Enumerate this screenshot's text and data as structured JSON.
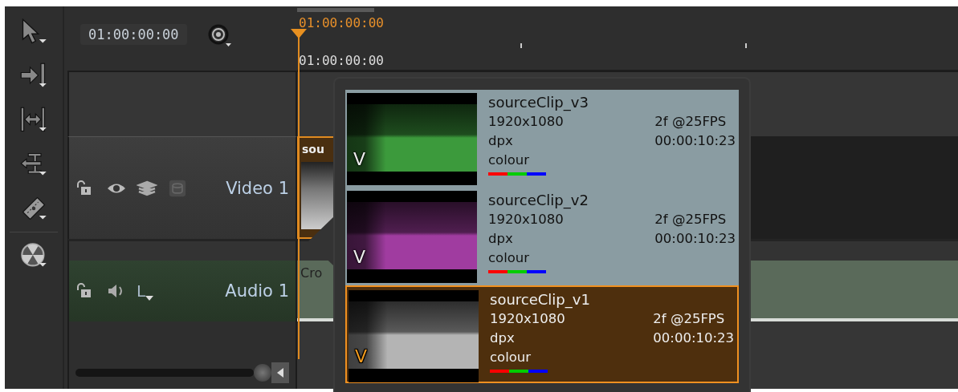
{
  "timecode_field": "01:00:00:00",
  "ruler": {
    "playhead_time": "01:00:00:00",
    "start_time": "01:00:00:00"
  },
  "tracks": [
    {
      "kind": "video",
      "name": "Video 1",
      "clip_label": "sou"
    },
    {
      "kind": "audio",
      "name": "Audio 1",
      "clip_label": "Cro",
      "channel": "L"
    }
  ],
  "version_popup": {
    "items": [
      {
        "name": "sourceClip_v3",
        "resolution": "1920x1080",
        "format": "dpx",
        "colourspace": "colour",
        "duration": "2f @25FPS",
        "timecode": "00:00:10:23",
        "badge": "V",
        "color": "#3c9a3c",
        "selected": false
      },
      {
        "name": "sourceClip_v2",
        "resolution": "1920x1080",
        "format": "dpx",
        "colourspace": "colour",
        "duration": "2f @25FPS",
        "timecode": "00:00:10:23",
        "badge": "V",
        "color": "#a03ca0",
        "selected": false
      },
      {
        "name": "sourceClip_v1",
        "resolution": "1920x1080",
        "format": "dpx",
        "colourspace": "colour",
        "duration": "2f @25FPS",
        "timecode": "00:00:10:23",
        "badge": "V",
        "color": "#b4b4b4",
        "selected": true
      }
    ]
  }
}
